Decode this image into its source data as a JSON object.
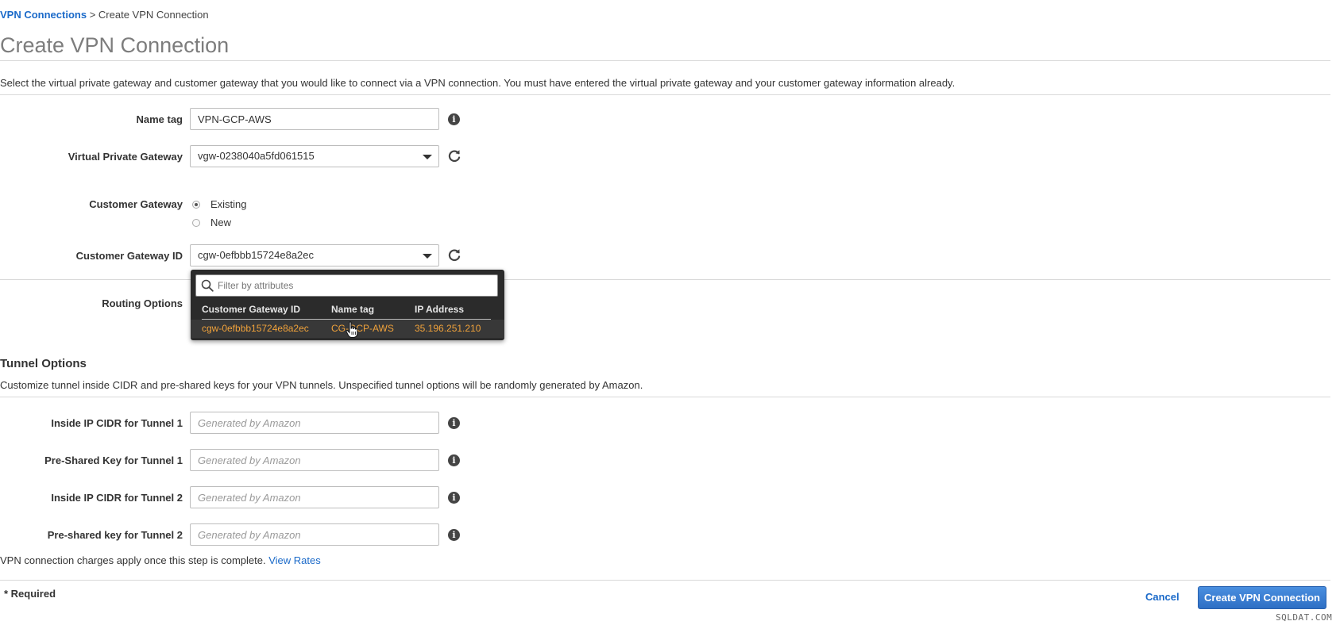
{
  "breadcrumb": {
    "parent": "VPN Connections",
    "separator": " > ",
    "current": "Create VPN Connection"
  },
  "page_title": "Create VPN Connection",
  "description": "Select the virtual private gateway and customer gateway that you would like to connect via a VPN connection. You must have entered the virtual private gateway and your customer gateway information already.",
  "form": {
    "name_tag": {
      "label": "Name tag",
      "value": "VPN-GCP-AWS"
    },
    "vpg": {
      "label": "Virtual Private Gateway",
      "value": "vgw-0238040a5fd061515"
    },
    "customer_gateway": {
      "label": "Customer Gateway",
      "options": [
        "Existing",
        "New"
      ],
      "selected": "Existing"
    },
    "cgw_id": {
      "label": "Customer Gateway ID",
      "value": "cgw-0efbbb15724e8a2ec"
    },
    "routing": {
      "label": "Routing Options"
    }
  },
  "dropdown": {
    "filter_placeholder": "Filter by attributes",
    "columns": [
      "Customer Gateway ID",
      "Name tag",
      "IP Address"
    ],
    "rows": [
      {
        "id": "cgw-0efbbb15724e8a2ec",
        "name": "CG-GCP-AWS",
        "ip": "35.196.251.210"
      }
    ]
  },
  "tunnel": {
    "title": "Tunnel Options",
    "description": "Customize tunnel inside CIDR and pre-shared keys for your VPN tunnels. Unspecified tunnel options will be randomly generated by Amazon.",
    "fields": [
      {
        "label": "Inside IP CIDR for Tunnel 1",
        "placeholder": "Generated by Amazon"
      },
      {
        "label": "Pre-Shared Key for Tunnel 1",
        "placeholder": "Generated by Amazon"
      },
      {
        "label": "Inside IP CIDR for Tunnel 2",
        "placeholder": "Generated by Amazon"
      },
      {
        "label": "Pre-shared key for Tunnel 2",
        "placeholder": "Generated by Amazon"
      }
    ]
  },
  "footer": {
    "charges_text": "VPN connection charges apply once this step is complete.",
    "view_rates": "View Rates",
    "required": "* Required",
    "cancel": "Cancel",
    "create": "Create VPN Connection"
  },
  "watermark": "SQLDAT.COM",
  "colors": {
    "link": "#1b6ac9",
    "primary_button": "#2e6fc4",
    "dropdown_bg": "#2b2b2b",
    "dropdown_highlight": "#f0a23b"
  },
  "icons": [
    "info-icon",
    "refresh-icon",
    "search-icon",
    "chevron-down-icon",
    "pointer-cursor-icon"
  ]
}
